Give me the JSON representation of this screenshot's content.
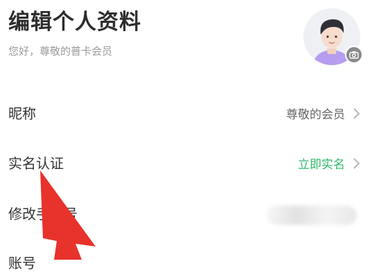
{
  "header": {
    "title": "编辑个人资料",
    "subtitle": "您好，尊敬的普卡会员"
  },
  "avatar": {
    "icon": "avatar-icon",
    "badge_icon": "camera-icon"
  },
  "rows": [
    {
      "label": "昵称",
      "value": "尊敬的会员"
    },
    {
      "label": "实名认证",
      "value": "立即实名"
    },
    {
      "label": "修改手机号"
    },
    {
      "label": "账号"
    }
  ],
  "colors": {
    "accent_green": "#2eb86a",
    "arrow_red": "#e8322c"
  }
}
